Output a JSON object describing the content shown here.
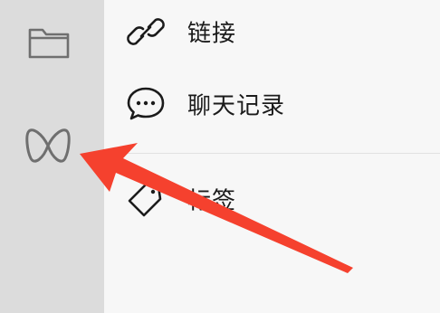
{
  "sidebar": {
    "items": [
      {
        "icon": "folder-icon"
      },
      {
        "icon": "mini-program-icon"
      }
    ]
  },
  "menu": {
    "items": [
      {
        "icon": "link-icon",
        "label": "链接"
      },
      {
        "icon": "chat-bubble-icon",
        "label": "聊天记录"
      },
      {
        "icon": "tag-icon",
        "label": "标签"
      }
    ]
  },
  "annotation": {
    "arrow_color": "#f5412e"
  },
  "colors": {
    "sidebar_bg": "#dcdcdc",
    "panel_bg": "#f7f7f7",
    "icon_stroke": "#5a5a5a"
  }
}
